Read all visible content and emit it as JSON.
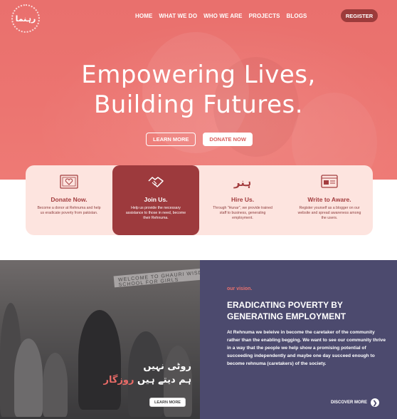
{
  "brand": {
    "logo_text": "رہنما"
  },
  "nav": {
    "items": [
      "HOME",
      "WHAT WE DO",
      "WHO WE ARE",
      "PROJECTS",
      "BLOGS"
    ],
    "register_label": "REGISTER"
  },
  "hero": {
    "title_line1": "Empowering Lives,",
    "title_line2": "Building Futures.",
    "learn_more_label": "LEARN MORE",
    "donate_label": "DONATE NOW"
  },
  "features": [
    {
      "icon": "heart-card-icon",
      "title": "Donate Now.",
      "desc": "Become a donor at Rehnuma and help us eradicate poverty from pakistan."
    },
    {
      "icon": "handshake-icon",
      "title": "Join Us.",
      "desc": "Help us provide the necessary assistance to those in need, become their Rehnuma."
    },
    {
      "icon": "hunar-icon",
      "title": "Hire Us.",
      "desc": "Through \"Hunar\", we provide trained staff to business, generating employment."
    },
    {
      "icon": "blog-icon",
      "title": "Write to Aware.",
      "desc": "Register yourself as a blogger on our website and spread awareness among the users."
    }
  ],
  "photo": {
    "banner_text": "WELCOME TO GHAURI WISDOM HIGH SCHOOL FOR GIRLS",
    "urdu_line1": "روٹی نہیں",
    "urdu_line2_prefix": "ہم دیتے ہیں",
    "urdu_line2_accent": "روزگار",
    "learn_more_label": "LEARN MORE"
  },
  "vision": {
    "label": "our vision.",
    "heading": "ERADICATING POVERTY BY GENERATING EMPLOYMENT",
    "body": "At Rehnuma we beleive in become the caretaker of the community rather than the enabling begging. We want to see our community thrive in a way that the people we help show a promising potential of succeeding independently and maybe one day succeed enough to  become rehnuma (caretakers) of the society.",
    "discover_label": "DISCOVER MORE"
  },
  "colors": {
    "hero": "#ec7470",
    "card_bg": "#fde4df",
    "active_card": "#9d3a3d",
    "vision_bg": "#4c4a6e",
    "accent": "#e96b67"
  }
}
